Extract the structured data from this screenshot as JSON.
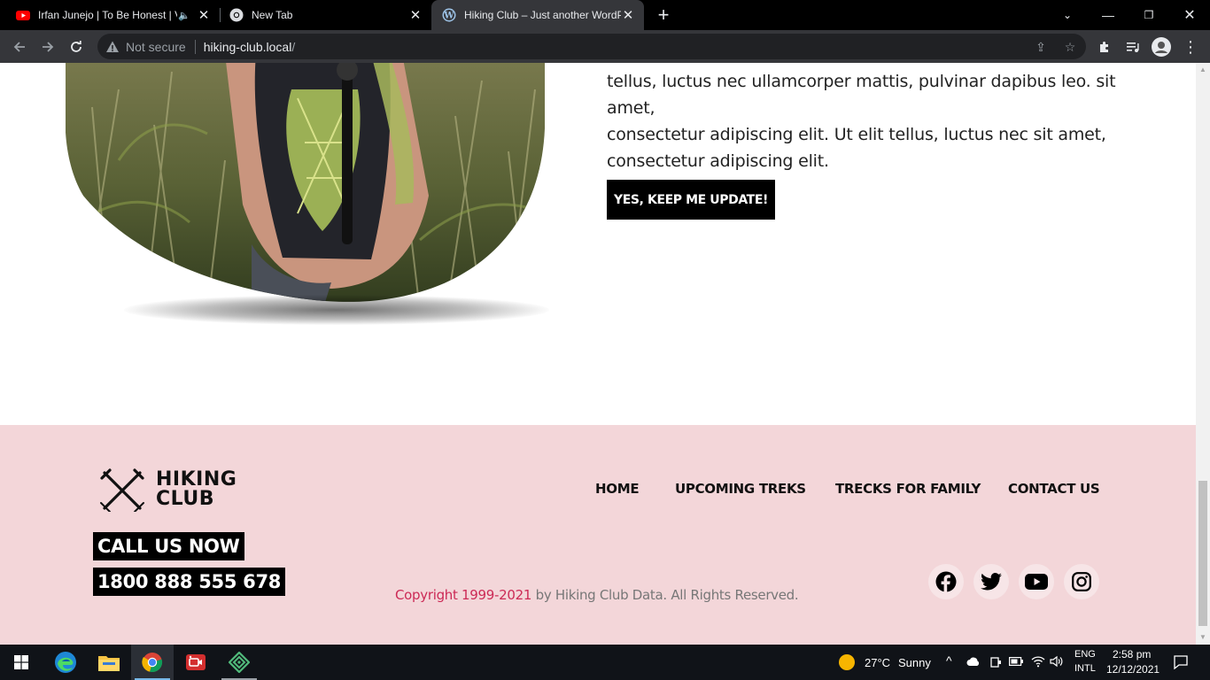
{
  "browser": {
    "tabs": [
      {
        "title": "Irfan Junejo | To Be Honest | V",
        "favicon": "youtube-icon",
        "audio": true
      },
      {
        "title": "New Tab",
        "favicon": "chrome-icon"
      },
      {
        "title": "Hiking Club – Just another WordP",
        "favicon": "wordpress-icon"
      }
    ],
    "address": {
      "security_label": "Not secure",
      "host": "hiking-club.local",
      "path": "/"
    }
  },
  "content": {
    "paragraph_lines": [
      "tellus, luctus nec ullamcorper mattis, pulvinar dapibus leo. sit amet,",
      "consectetur adipiscing elit. Ut elit tellus, luctus nec sit amet,",
      "consectetur adipiscing elit."
    ],
    "cta_label": "YES, KEEP ME UPDATE!"
  },
  "footer": {
    "logo": {
      "line1": "HIKING",
      "line2": "CLUB"
    },
    "nav": [
      "HOME",
      "UPCOMING TREKS",
      "TRECKS FOR FAMILY",
      "CONTACT US"
    ],
    "call_label": "CALL US NOW",
    "phone": "1800 888 555 678",
    "copyright_accent": "Copyright 1999-2021",
    "copyright_rest": " by Hiking Club Data. All Rights Reserved.",
    "social": [
      "facebook-icon",
      "twitter-icon",
      "youtube-icon",
      "instagram-icon"
    ],
    "colors": {
      "background": "#f3d6d9",
      "accent": "#cc2a56"
    }
  },
  "taskbar": {
    "weather_temp": "27°C",
    "weather_text": "Sunny",
    "language_line1": "ENG",
    "language_line2": "INTL",
    "time": "2:58 pm",
    "date": "12/12/2021"
  }
}
